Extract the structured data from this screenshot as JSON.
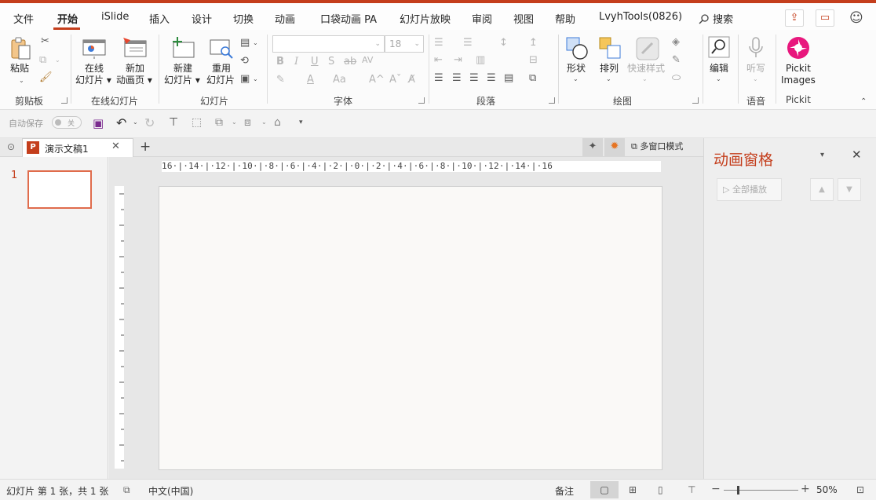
{
  "colors": {
    "accent": "#c43e1c",
    "pickit": "#e8177d"
  },
  "tabs": {
    "file": "文件",
    "home": "开始",
    "islide": "iSlide",
    "insert": "插入",
    "design": "设计",
    "transitions": "切换",
    "animations": "动画",
    "pocket": "口袋动画 PA",
    "slideshow": "幻灯片放映",
    "review": "审阅",
    "view": "视图",
    "help": "帮助",
    "lvyh": "LvyhTools(0826)",
    "search": "搜索"
  },
  "ribbon": {
    "clipboard": {
      "paste": "粘贴",
      "label": "剪贴板"
    },
    "online": {
      "online_slide_1": "在线",
      "online_slide_2": "幻灯片",
      "add_anim_1": "新加",
      "add_anim_2": "动画页",
      "label": "在线幻灯片"
    },
    "slides": {
      "new_1": "新建",
      "new_2": "幻灯片",
      "reuse_1": "重用",
      "reuse_2": "幻灯片",
      "label": "幻灯片"
    },
    "font": {
      "size": "18",
      "label": "字体"
    },
    "paragraph": {
      "label": "段落"
    },
    "drawing": {
      "shape": "形状",
      "arrange": "排列",
      "quick_style": "快速样式",
      "label": "绘图"
    },
    "editing": {
      "edit": "编辑"
    },
    "voice": {
      "dictate": "听写",
      "label": "语音"
    },
    "pickit": {
      "name_1": "Pickit",
      "name_2": "Images",
      "label": "Pickit"
    }
  },
  "qat": {
    "autosave": "自动保存",
    "toggle": "关"
  },
  "doc": {
    "tab_title": "演示文稿1",
    "multi_window": "多窗口模式"
  },
  "thumbs": {
    "slide_number": "1"
  },
  "ruler": {
    "h_ticks": "16·|·14·|·12·|·10·|·8·|·6·|·4·|·2·|·0·|·2·|·4·|·6·|·8·|·10·|·12·|·14·|·16"
  },
  "anim_pane": {
    "title": "动画窗格",
    "play_all": "全部播放"
  },
  "status": {
    "slide_info": "幻灯片 第 1 张，共 1 张",
    "language": "中文(中国)",
    "notes": "备注",
    "zoom": "50%"
  }
}
